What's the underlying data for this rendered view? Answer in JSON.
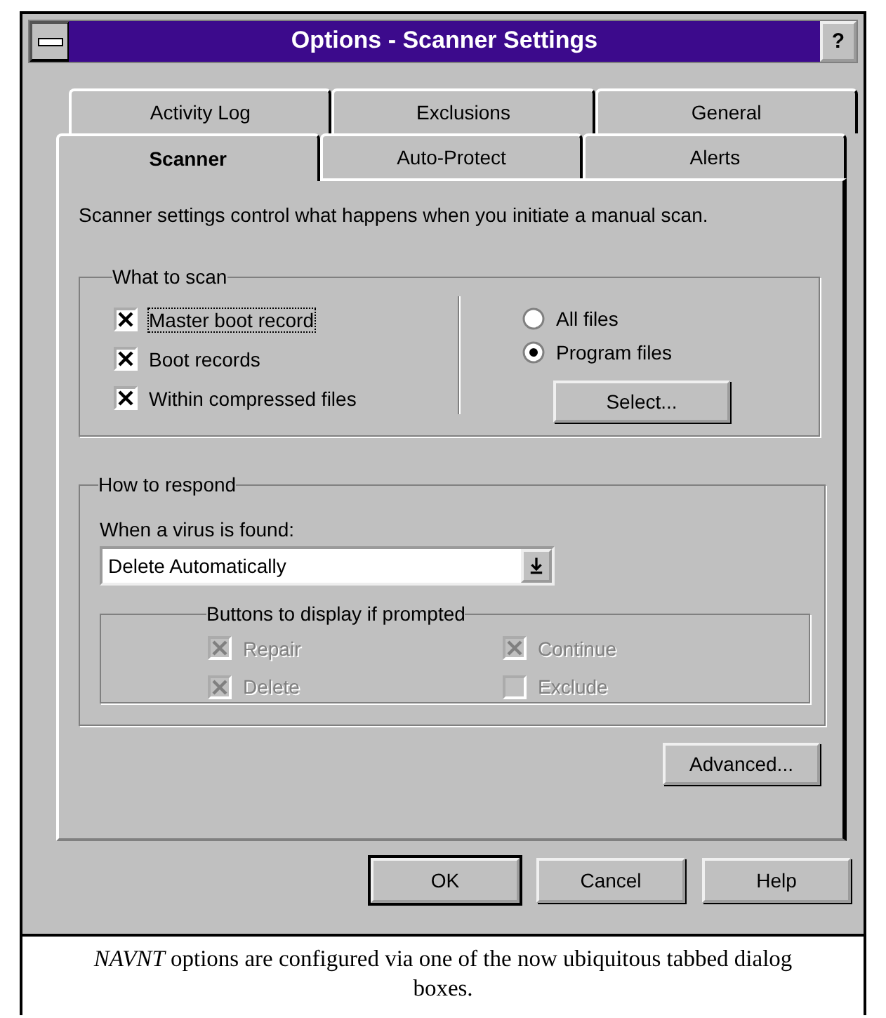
{
  "window": {
    "title": "Options - Scanner Settings",
    "help_button": "?"
  },
  "tab_rows": [
    [
      {
        "label": "Activity Log",
        "selected": false
      },
      {
        "label": "Exclusions",
        "selected": false
      },
      {
        "label": "General",
        "selected": false
      }
    ],
    [
      {
        "label": "Scanner",
        "selected": true
      },
      {
        "label": "Auto-Protect",
        "selected": false
      },
      {
        "label": "Alerts",
        "selected": false
      }
    ]
  ],
  "description": "Scanner settings control what happens when you initiate a manual scan.",
  "what_to_scan": {
    "title": "What to scan",
    "checkboxes": [
      {
        "label": "Master boot record",
        "checked": true,
        "focused": true
      },
      {
        "label": "Boot records",
        "checked": true,
        "focused": false
      },
      {
        "label": "Within compressed files",
        "checked": true,
        "focused": false
      }
    ],
    "file_types": [
      {
        "label": "All files",
        "selected": false
      },
      {
        "label": "Program files",
        "selected": true
      }
    ],
    "select_button": "Select..."
  },
  "how_to_respond": {
    "title": "How to respond",
    "when_label": "When a virus is found:",
    "action_dropdown": {
      "value": "Delete Automatically"
    },
    "prompt_buttons": {
      "title": "Buttons to display if prompted",
      "disabled": true,
      "checkboxes": [
        {
          "label": "Repair",
          "checked": true
        },
        {
          "label": "Continue",
          "checked": true
        },
        {
          "label": "Delete",
          "checked": true
        },
        {
          "label": "Exclude",
          "checked": false
        }
      ]
    }
  },
  "advanced_button": "Advanced...",
  "buttons": [
    {
      "label": "OK",
      "default": true
    },
    {
      "label": "Cancel",
      "default": false
    },
    {
      "label": "Help",
      "default": false
    }
  ],
  "caption": "*NAVNT* options are configured via one of the now ubiquitous tabbed dialog boxes."
}
